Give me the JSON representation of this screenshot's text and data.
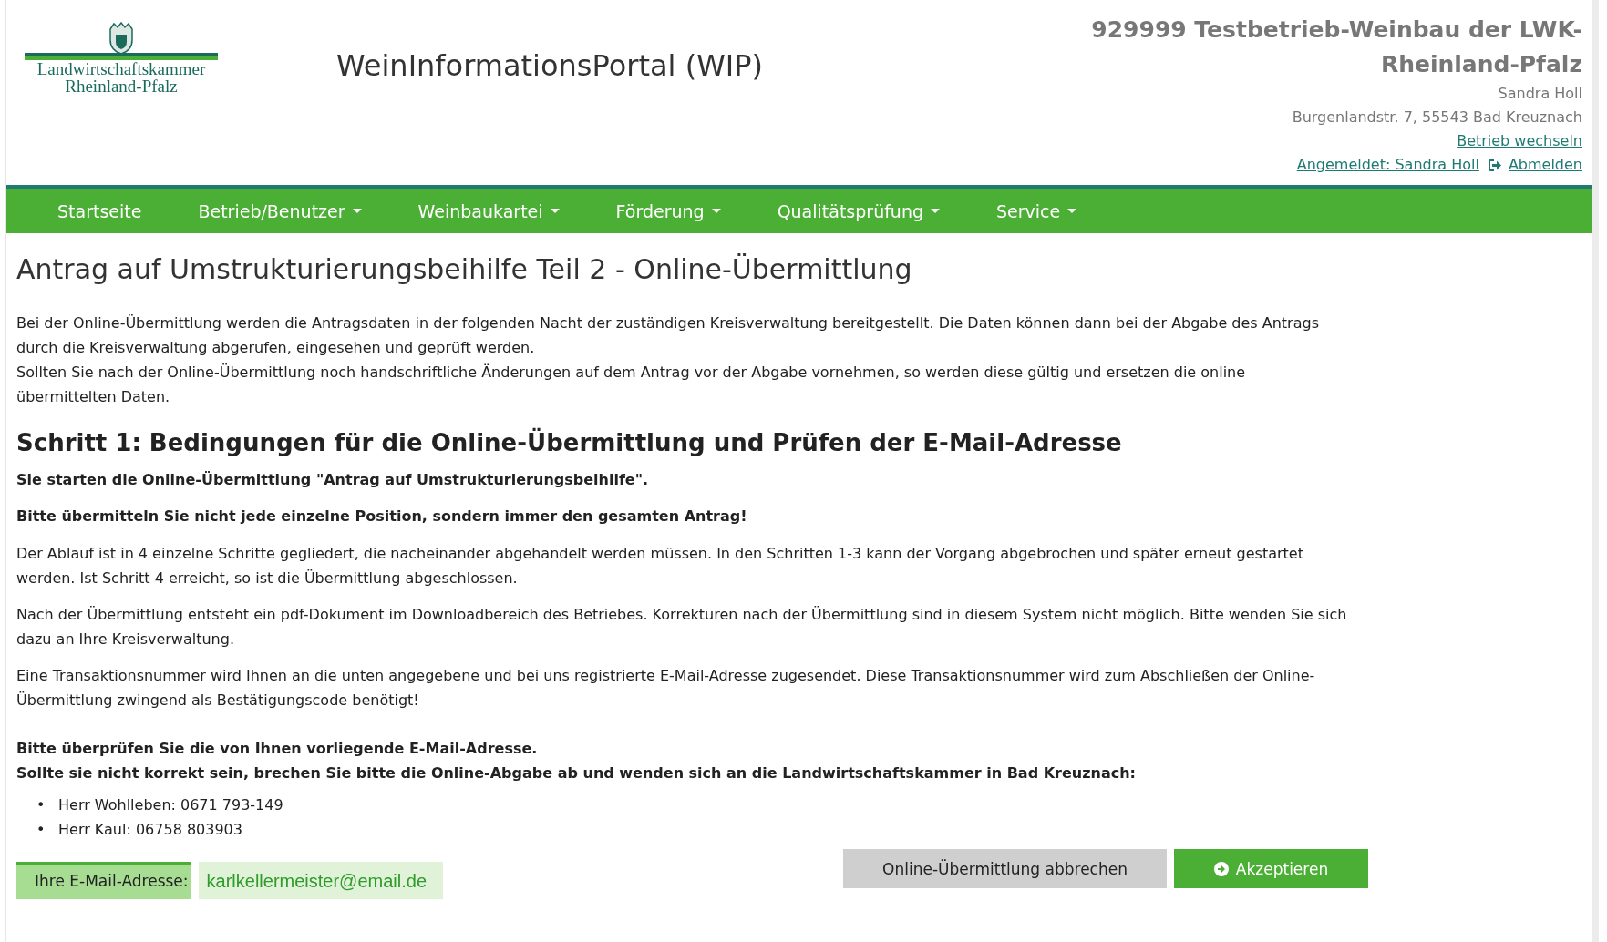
{
  "header": {
    "logo": {
      "line1": "Landwirtschaftskammer",
      "line2": "Rheinland-Pfalz"
    },
    "portal_title": "WeinInformationsPortal (WIP)",
    "company": {
      "name": "929999 Testbetrieb-Weinbau der LWK-Rheinland-Pfalz",
      "contact": "Sandra Holl",
      "address": "Burgenlandstr. 7, 55543 Bad Kreuznach"
    },
    "switch_link": "Betrieb wechseln",
    "logged_in_link": "Angemeldet: Sandra Holl",
    "logout_link": "Abmelden"
  },
  "nav": {
    "items": [
      {
        "label": "Startseite",
        "dropdown": false
      },
      {
        "label": "Betrieb/Benutzer",
        "dropdown": true
      },
      {
        "label": "Weinbaukartei",
        "dropdown": true
      },
      {
        "label": "Förderung",
        "dropdown": true
      },
      {
        "label": "Qualitätsprüfung",
        "dropdown": true
      },
      {
        "label": "Service",
        "dropdown": true
      }
    ]
  },
  "page_title": "Antrag auf Umstrukturierungsbeihilfe Teil 2 - Online-Übermittlung",
  "intro": [
    "Bei der Online-Übermittlung werden die Antragsdaten in der folgenden Nacht der zuständigen Kreisverwaltung bereitgestellt. Die Daten können dann bei der Abgabe des Antrags durch die Kreisverwaltung abgerufen, eingesehen und geprüft werden.",
    "Sollten Sie nach der Online-Übermittlung noch handschriftliche Änderungen auf dem Antrag vor der Abgabe vornehmen, so werden diese gültig und ersetzen die online übermittelten Daten."
  ],
  "step": {
    "heading": "Schritt 1: Bedingungen für die Online-Übermittlung und Prüfen der E-Mail-Adresse",
    "notes": [
      "Sie starten die Online-Übermittlung \"Antrag auf Umstrukturierungsbeihilfe\".",
      "Bitte übermitteln Sie nicht jede einzelne Position, sondern immer den gesamten Antrag!"
    ],
    "paragraphs": [
      "Der Ablauf ist in 4 einzelne Schritte gegliedert, die nacheinander abgehandelt werden müssen. In den Schritten 1-3 kann der Vorgang abgebrochen und später erneut gestartet werden. Ist Schritt 4 erreicht, so ist die Übermittlung abgeschlossen.",
      "Nach der Übermittlung entsteht ein pdf-Dokument im Downloadbereich des Betriebes. Korrekturen nach der Übermittlung sind in diesem System nicht möglich. Bitte wenden Sie sich dazu an Ihre Kreisverwaltung.",
      "Eine Transaktionsnummer wird Ihnen an die unten angegebene und bei uns registrierte E-Mail-Adresse zugesendet. Diese Transaktionsnummer wird zum Abschließen der Online-Übermittlung zwingend als Bestätigungscode benötigt!"
    ],
    "check_lines": [
      "Bitte überprüfen Sie die von Ihnen vorliegende E-Mail-Adresse.",
      "Sollte sie nicht korrekt sein, brechen Sie bitte die Online-Abgabe ab und wenden sich an die Landwirtschaftskammer in Bad Kreuznach:"
    ],
    "contacts": [
      {
        "marker": "•",
        "text": "Herr Wohlleben: 0671 793-149"
      },
      {
        "marker": "•",
        "text": "Herr Kaul: 06758 803903"
      }
    ]
  },
  "email": {
    "label": "Ihre E-Mail-Adresse:",
    "value": "karlkellermeister@email.de"
  },
  "buttons": {
    "cancel": "Online-Übermittlung abbrechen",
    "accept": "Akzeptieren"
  }
}
